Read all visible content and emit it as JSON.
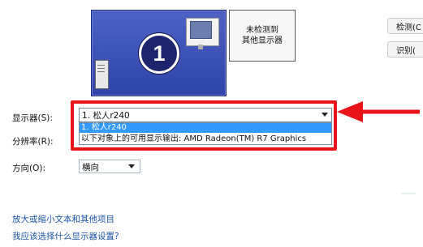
{
  "monitors": {
    "primary_number": "1",
    "secondary_line1": "未检测到",
    "secondary_line2": "其他显示器"
  },
  "buttons": {
    "detect": "检测(C",
    "identify": "识别("
  },
  "labels": {
    "display": "显示器(S):",
    "resolution": "分辨率(R):",
    "orientation": "方向(O):"
  },
  "display_select": {
    "value": "1. 松人r240",
    "options": [
      "1. 松人r240",
      "以下对象上的可用显示输出: AMD Radeon(TM) R7 Graphics"
    ]
  },
  "orientation_select": {
    "value": "横向"
  },
  "links": {
    "text_size": "放大或缩小文本和其他项目",
    "which_setting": "我应该选择什么显示器设置?"
  },
  "colors": {
    "highlight": "#e8141a",
    "selection": "#3399ff",
    "link": "#1a55a8"
  }
}
